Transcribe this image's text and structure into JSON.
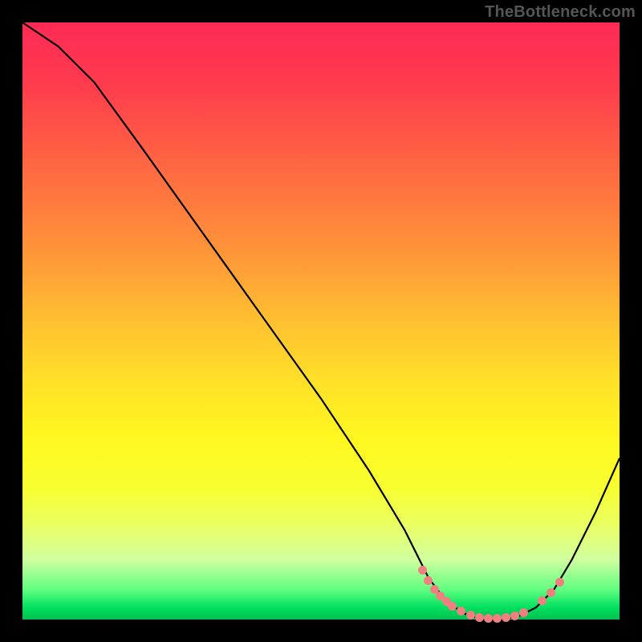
{
  "attribution": "TheBottleneck.com",
  "chart_data": {
    "type": "line",
    "title": "",
    "xlabel": "",
    "ylabel": "",
    "xlim": [
      0,
      1
    ],
    "ylim": [
      0,
      1
    ],
    "curve": [
      {
        "x": 0.0,
        "y": 1.0
      },
      {
        "x": 0.06,
        "y": 0.96
      },
      {
        "x": 0.12,
        "y": 0.9
      },
      {
        "x": 0.2,
        "y": 0.79
      },
      {
        "x": 0.3,
        "y": 0.65
      },
      {
        "x": 0.4,
        "y": 0.51
      },
      {
        "x": 0.5,
        "y": 0.37
      },
      {
        "x": 0.58,
        "y": 0.25
      },
      {
        "x": 0.64,
        "y": 0.15
      },
      {
        "x": 0.68,
        "y": 0.07
      },
      {
        "x": 0.71,
        "y": 0.03
      },
      {
        "x": 0.74,
        "y": 0.01
      },
      {
        "x": 0.77,
        "y": 0.0
      },
      {
        "x": 0.8,
        "y": 0.0
      },
      {
        "x": 0.83,
        "y": 0.005
      },
      {
        "x": 0.86,
        "y": 0.02
      },
      {
        "x": 0.89,
        "y": 0.05
      },
      {
        "x": 0.92,
        "y": 0.1
      },
      {
        "x": 0.96,
        "y": 0.18
      },
      {
        "x": 1.0,
        "y": 0.27
      }
    ],
    "dots": [
      {
        "x": 0.67,
        "y": 0.082
      },
      {
        "x": 0.68,
        "y": 0.065
      },
      {
        "x": 0.69,
        "y": 0.05
      },
      {
        "x": 0.7,
        "y": 0.04
      },
      {
        "x": 0.71,
        "y": 0.03
      },
      {
        "x": 0.72,
        "y": 0.022
      },
      {
        "x": 0.735,
        "y": 0.014
      },
      {
        "x": 0.75,
        "y": 0.008
      },
      {
        "x": 0.765,
        "y": 0.004
      },
      {
        "x": 0.78,
        "y": 0.002
      },
      {
        "x": 0.795,
        "y": 0.002
      },
      {
        "x": 0.81,
        "y": 0.003
      },
      {
        "x": 0.825,
        "y": 0.006
      },
      {
        "x": 0.84,
        "y": 0.012
      },
      {
        "x": 0.87,
        "y": 0.032
      },
      {
        "x": 0.885,
        "y": 0.045
      },
      {
        "x": 0.9,
        "y": 0.062
      }
    ],
    "gradient_colors": {
      "top": "#ff2a55",
      "mid": "#ffe028",
      "bottom": "#00c050"
    },
    "dot_color": "#f08080"
  }
}
